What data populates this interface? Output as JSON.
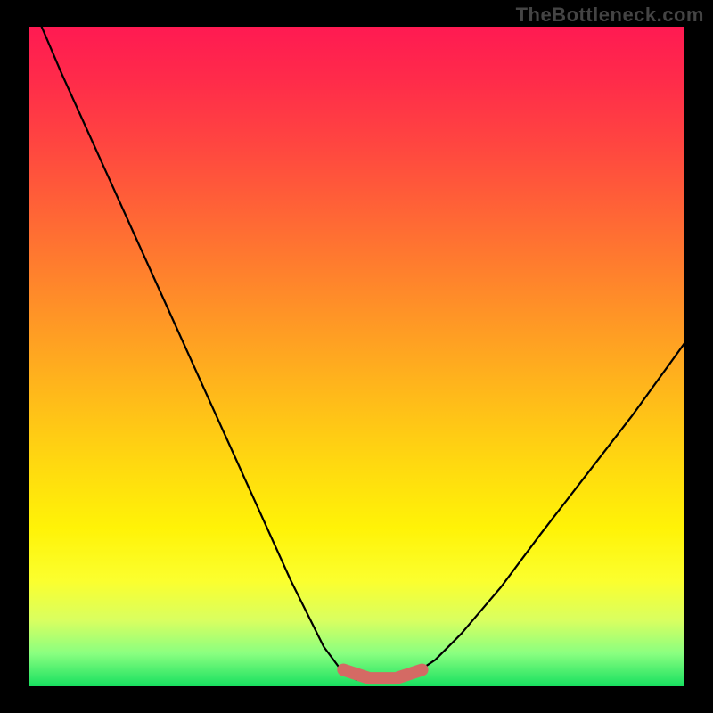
{
  "watermark": "TheBottleneck.com",
  "chart_data": {
    "type": "line",
    "title": "",
    "xlabel": "",
    "ylabel": "",
    "xlim": [
      0,
      100
    ],
    "ylim": [
      0,
      100
    ],
    "grid": false,
    "legend": false,
    "series": [
      {
        "name": "bottleneck-curve",
        "x": [
          2,
          5,
          10,
          15,
          20,
          25,
          30,
          35,
          40,
          45,
          48,
          50,
          53,
          56,
          59,
          62,
          66,
          72,
          78,
          85,
          92,
          100
        ],
        "y": [
          100,
          93,
          82,
          71,
          60,
          49,
          38,
          27,
          16,
          6,
          2,
          1,
          1,
          1,
          2,
          4,
          8,
          15,
          23,
          32,
          41,
          52
        ]
      }
    ],
    "annotations": [
      {
        "name": "bottom-flat-highlight",
        "x": [
          48,
          60
        ],
        "y": [
          1.5,
          1.5
        ],
        "color": "#d46a64"
      }
    ],
    "background_gradient": {
      "top": "#ff1a52",
      "bottom": "#18e060",
      "stops": [
        "#ff1a52",
        "#ff6a34",
        "#ffd810",
        "#fbff2e",
        "#18e060"
      ]
    }
  }
}
